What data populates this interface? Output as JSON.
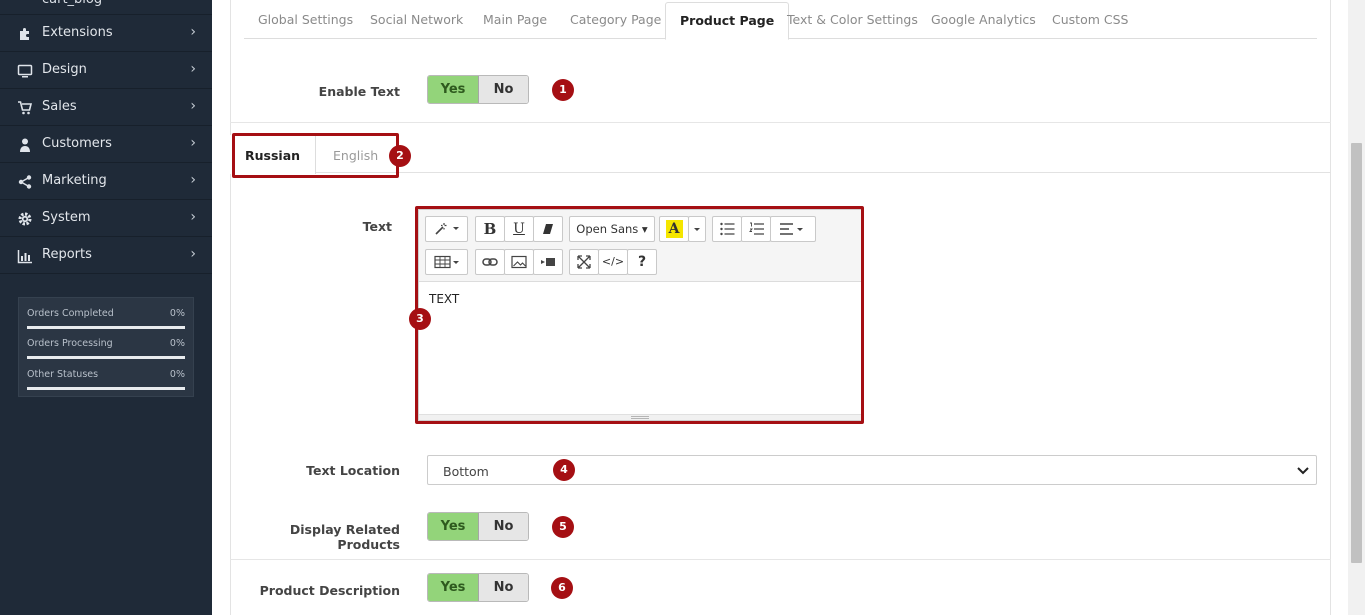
{
  "sidebar": {
    "partial_item": "cart_blog",
    "items": [
      {
        "label": "Extensions",
        "icon": "puzzle-icon"
      },
      {
        "label": "Design",
        "icon": "monitor-icon"
      },
      {
        "label": "Sales",
        "icon": "cart-icon"
      },
      {
        "label": "Customers",
        "icon": "user-icon"
      },
      {
        "label": "Marketing",
        "icon": "share-icon"
      },
      {
        "label": "System",
        "icon": "gear-icon"
      },
      {
        "label": "Reports",
        "icon": "bar-chart-icon"
      }
    ],
    "chevron": "›",
    "stats": [
      {
        "label": "Orders Completed",
        "percent": "0%",
        "fill": 0.0
      },
      {
        "label": "Orders Processing",
        "percent": "0%",
        "fill": 0.0
      },
      {
        "label": "Other Statuses",
        "percent": "0%",
        "fill": 0.0
      }
    ]
  },
  "tabs": [
    {
      "label": "Global Settings",
      "active": false
    },
    {
      "label": "Social Network",
      "active": false
    },
    {
      "label": "Main Page",
      "active": false
    },
    {
      "label": "Category Page",
      "active": false
    },
    {
      "label": "Product Page",
      "active": true
    },
    {
      "label": "Text & Color Settings",
      "active": false
    },
    {
      "label": "Google Analytics",
      "active": false
    },
    {
      "label": "Custom CSS",
      "active": false
    }
  ],
  "form": {
    "enable_text": {
      "label": "Enable Text",
      "yes": "Yes",
      "no": "No",
      "value": "Yes",
      "marker": "1"
    },
    "language_tabs": {
      "items": [
        "Russian",
        "English"
      ],
      "active": "Russian",
      "marker": "2"
    },
    "text": {
      "label": "Text",
      "content": "TEXT",
      "marker": "3",
      "font_dropdown": "Open Sans",
      "highlight_glyph": "A",
      "help_glyph": "?",
      "bold_glyph": "B",
      "underline_glyph": "U",
      "code_glyph": "</>"
    },
    "text_location": {
      "label": "Text Location",
      "value": "Bottom",
      "marker": "4"
    },
    "display_related": {
      "label": "Display Related Products",
      "yes": "Yes",
      "no": "No",
      "value": "Yes",
      "marker": "5"
    },
    "product_description": {
      "label": "Product Description",
      "yes": "Yes",
      "no": "No",
      "value": "Yes",
      "marker": "6"
    }
  },
  "colors": {
    "sidebar_bg": "#1f2a38",
    "marker": "#a50f13",
    "toggle_yes": "#93d47a",
    "highlight_yellow": "#f5e600"
  }
}
